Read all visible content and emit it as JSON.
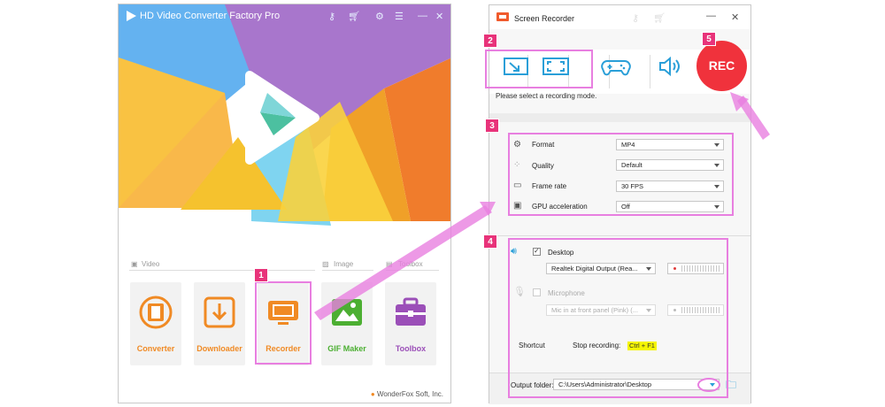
{
  "main_window": {
    "title": "HD Video Converter Factory Pro",
    "sections": {
      "video": "Video",
      "image": "Image",
      "toolbox": "Toolbox"
    },
    "tiles": [
      {
        "label": "Converter",
        "color": "#f08a24",
        "icon": "film-icon"
      },
      {
        "label": "Downloader",
        "color": "#f08a24",
        "icon": "download-icon"
      },
      {
        "label": "Recorder",
        "color": "#f08a24",
        "icon": "screen-record-icon"
      },
      {
        "label": "GIF Maker",
        "color": "#4caf32",
        "icon": "image-icon"
      },
      {
        "label": "Toolbox",
        "color": "#9b4fb8",
        "icon": "toolbox-icon"
      }
    ],
    "footer": "WonderFox Soft, Inc."
  },
  "recorder_window": {
    "title": "Screen Recorder",
    "rec_label": "REC",
    "hint": "Please select a recording mode.",
    "settings": [
      {
        "label": "Format",
        "value": "MP4",
        "icon": "gear-icon"
      },
      {
        "label": "Quality",
        "value": "Default",
        "icon": "quality-icon"
      },
      {
        "label": "Frame rate",
        "value": "30 FPS",
        "icon": "film-frame-icon"
      },
      {
        "label": "GPU acceleration",
        "value": "Off",
        "icon": "chip-icon"
      }
    ],
    "audio": {
      "desktop_label": "Desktop",
      "desktop_device": "Realtek Digital Output (Rea...",
      "mic_label": "Microphone",
      "mic_device": "Mic in at front panel (Pink) (...",
      "desktop_checked": true,
      "mic_checked": false
    },
    "shortcut": {
      "label": "Shortcut",
      "action": "Stop recording:",
      "keys": "Ctrl + F1"
    },
    "output_label": "Output folder:",
    "output_path": "C:\\Users\\Administrator\\Desktop"
  },
  "badges": [
    "1",
    "2",
    "3",
    "4",
    "5"
  ],
  "colors": {
    "accent_pink": "#e87fe0",
    "badge": "#e8337a",
    "rec_red": "#f0323c",
    "mode_blue": "#2a9fd8"
  }
}
